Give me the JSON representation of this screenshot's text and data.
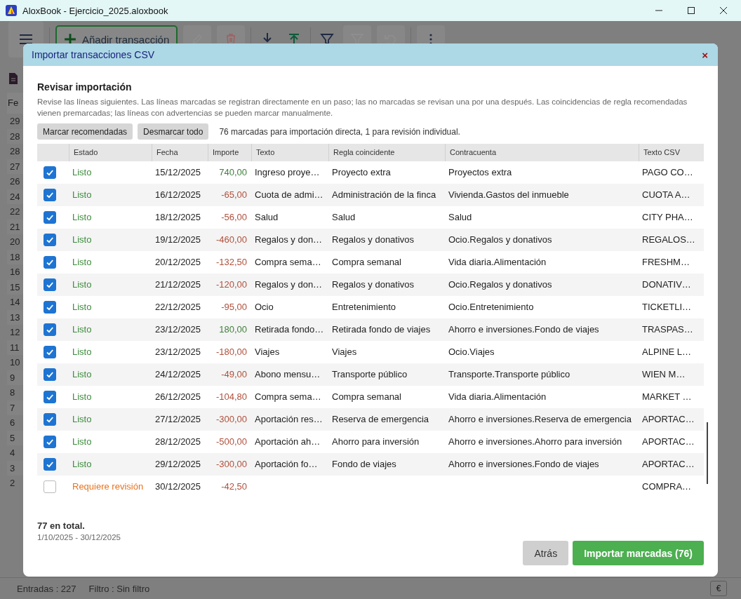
{
  "window": {
    "title": "AloxBook - Ejercicio_2025.aloxbook"
  },
  "background": {
    "add_button": "Añadir transacción",
    "column_header": "Fe",
    "dates": [
      "29",
      "28",
      "28",
      "27",
      "26",
      "24",
      "22",
      "21",
      "20",
      "18",
      "16",
      "15",
      "14",
      "13",
      "12",
      "11",
      "10",
      "9",
      "8",
      "7",
      "6",
      "5",
      "4",
      "3",
      "2"
    ],
    "status_bar": {
      "entries": "Entradas : 227",
      "filter": "Filtro : Sin filtro",
      "currency": "€"
    }
  },
  "dialog": {
    "title": "Importar transacciones CSV",
    "close": "×",
    "heading": "Revisar importación",
    "description": "Revise las líneas siguientes. Las líneas marcadas se registran directamente en un paso; las no marcadas se revisan una por una después. Las coincidencias de regla recomendadas vienen premarcadas; las líneas con advertencias se pueden marcar manualmente.",
    "actions": [
      "Marcar recomendadas",
      "Desmarcar todo"
    ],
    "summary": "76 marcadas para importación directa, 1 para revisión individual.",
    "table": {
      "columns": [
        "Estado",
        "Fecha",
        "Importe",
        "Texto",
        "Regla coincidente",
        "Contracuenta",
        "Texto CSV"
      ],
      "rows": [
        {
          "checked": true,
          "kind": "ready",
          "status": "Listo",
          "date": "15/12/2025",
          "amount": "740,00",
          "income": true,
          "text": "Ingreso proye…",
          "rule": "Proyecto extra",
          "account": "Proyectos extra",
          "csv": "PAGO CO…"
        },
        {
          "checked": true,
          "kind": "ready",
          "status": "Listo",
          "date": "16/12/2025",
          "amount": "-65,00",
          "income": false,
          "text": "Cuota de admi…",
          "rule": "Administración de la finca",
          "account": "Vivienda.Gastos del inmueble",
          "csv": "CUOTA A…"
        },
        {
          "checked": true,
          "kind": "ready",
          "status": "Listo",
          "date": "18/12/2025",
          "amount": "-56,00",
          "income": false,
          "text": "Salud",
          "rule": "Salud",
          "account": "Salud",
          "csv": "CITY PHA…"
        },
        {
          "checked": true,
          "kind": "ready",
          "status": "Listo",
          "date": "19/12/2025",
          "amount": "-460,00",
          "income": false,
          "text": "Regalos y don…",
          "rule": "Regalos y donativos",
          "account": "Ocio.Regalos y donativos",
          "csv": "REGALOS…"
        },
        {
          "checked": true,
          "kind": "ready",
          "status": "Listo",
          "date": "20/12/2025",
          "amount": "-132,50",
          "income": false,
          "text": "Compra sema…",
          "rule": "Compra semanal",
          "account": "Vida diaria.Alimentación",
          "csv": "FRESHM…"
        },
        {
          "checked": true,
          "kind": "ready",
          "status": "Listo",
          "date": "21/12/2025",
          "amount": "-120,00",
          "income": false,
          "text": "Regalos y don…",
          "rule": "Regalos y donativos",
          "account": "Ocio.Regalos y donativos",
          "csv": "DONATIV…"
        },
        {
          "checked": true,
          "kind": "ready",
          "status": "Listo",
          "date": "22/12/2025",
          "amount": "-95,00",
          "income": false,
          "text": "Ocio",
          "rule": "Entretenimiento",
          "account": "Ocio.Entretenimiento",
          "csv": "TICKETLI…"
        },
        {
          "checked": true,
          "kind": "ready",
          "status": "Listo",
          "date": "23/12/2025",
          "amount": "180,00",
          "income": true,
          "text": "Retirada fondo…",
          "rule": "Retirada fondo de viajes",
          "account": "Ahorro e inversiones.Fondo de viajes",
          "csv": "TRASPAS…"
        },
        {
          "checked": true,
          "kind": "ready",
          "status": "Listo",
          "date": "23/12/2025",
          "amount": "-180,00",
          "income": false,
          "text": "Viajes",
          "rule": "Viajes",
          "account": "Ocio.Viajes",
          "csv": "ALPINE L…"
        },
        {
          "checked": true,
          "kind": "ready",
          "status": "Listo",
          "date": "24/12/2025",
          "amount": "-49,00",
          "income": false,
          "text": "Abono mensu…",
          "rule": "Transporte público",
          "account": "Transporte.Transporte público",
          "csv": "WIEN M…"
        },
        {
          "checked": true,
          "kind": "ready",
          "status": "Listo",
          "date": "26/12/2025",
          "amount": "-104,80",
          "income": false,
          "text": "Compra sema…",
          "rule": "Compra semanal",
          "account": "Vida diaria.Alimentación",
          "csv": "MARKET …"
        },
        {
          "checked": true,
          "kind": "ready",
          "status": "Listo",
          "date": "27/12/2025",
          "amount": "-300,00",
          "income": false,
          "text": "Aportación res…",
          "rule": "Reserva de emergencia",
          "account": "Ahorro e inversiones.Reserva de emergencia",
          "csv": "APORTAC…"
        },
        {
          "checked": true,
          "kind": "ready",
          "status": "Listo",
          "date": "28/12/2025",
          "amount": "-500,00",
          "income": false,
          "text": "Aportación ah…",
          "rule": "Ahorro para inversión",
          "account": "Ahorro e inversiones.Ahorro para inversión",
          "csv": "APORTAC…"
        },
        {
          "checked": true,
          "kind": "ready",
          "status": "Listo",
          "date": "29/12/2025",
          "amount": "-300,00",
          "income": false,
          "text": "Aportación fo…",
          "rule": "Fondo de viajes",
          "account": "Ahorro e inversiones.Fondo de viajes",
          "csv": "APORTAC…"
        },
        {
          "checked": false,
          "kind": "review",
          "status": "Requiere revisión",
          "date": "30/12/2025",
          "amount": "-42,50",
          "income": false,
          "csv": "COMPRA…"
        }
      ]
    },
    "total": "77 en total.",
    "range": "1/10/2025 - 30/12/2025",
    "buttons": [
      {
        "label": "Atrás",
        "kind": "secondary"
      },
      {
        "label": "Importar marcadas (76)",
        "kind": "primary"
      }
    ]
  }
}
